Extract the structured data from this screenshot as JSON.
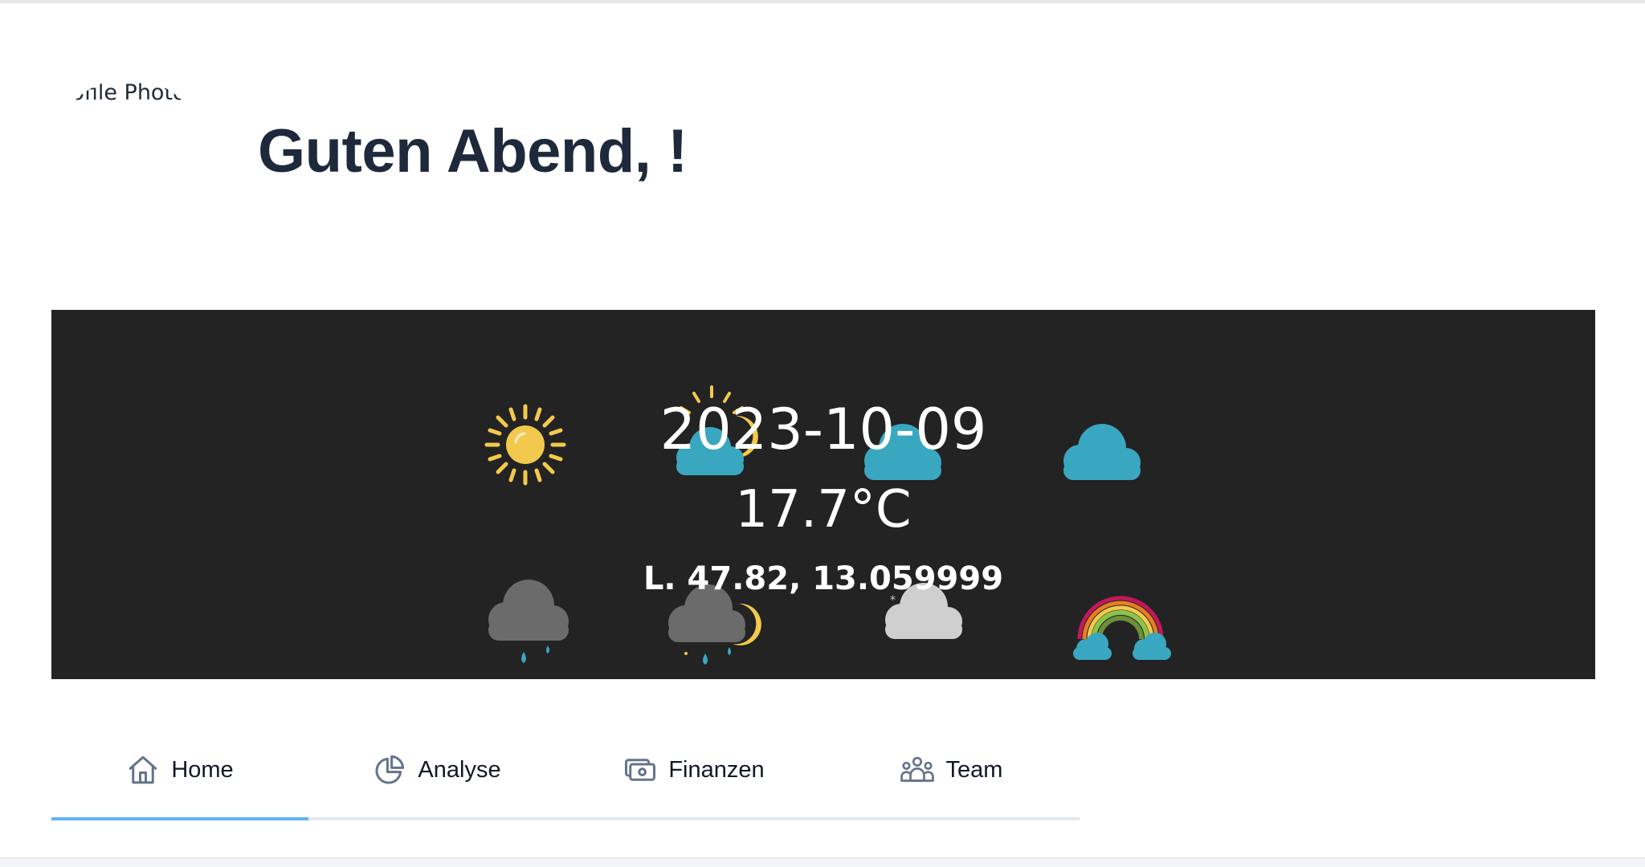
{
  "header": {
    "avatar_alt": "Profile Photo",
    "greeting": "Guten Abend, !"
  },
  "weather": {
    "date": "2023-10-09",
    "temperature": "17.7°C",
    "coordinates": "L. 47.82, 13.059999",
    "background_color": "#232323",
    "background_icons": [
      "sun-icon",
      "partly-cloudy-night-icon",
      "cloud-icon",
      "cloud-icon",
      "rain-icon",
      "night-rain-icon",
      "snow-cloud-icon",
      "rainbow-icon"
    ]
  },
  "tabs": [
    {
      "label": "Home",
      "icon": "home-icon",
      "active": true
    },
    {
      "label": "Analyse",
      "icon": "pie-chart-icon",
      "active": false
    },
    {
      "label": "Finanzen",
      "icon": "money-icon",
      "active": false
    },
    {
      "label": "Team",
      "icon": "team-icon",
      "active": false
    }
  ],
  "colors": {
    "accent": "#63b3ed",
    "text_dark": "#1e293b",
    "icon_gray": "#64748b"
  }
}
